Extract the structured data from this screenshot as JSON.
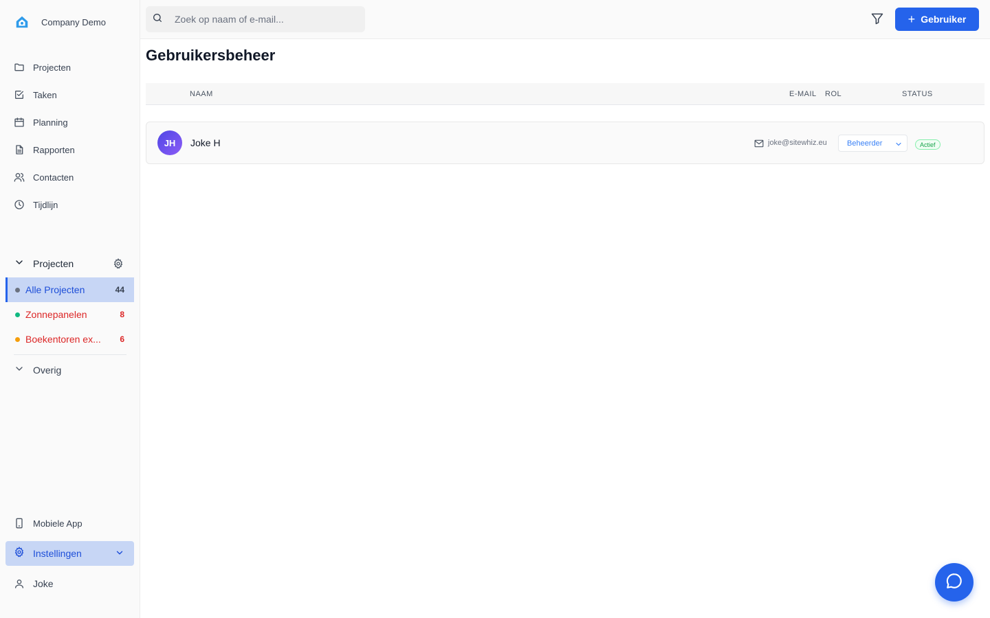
{
  "brand": {
    "name": "Company Demo"
  },
  "nav": [
    {
      "label": "Projecten",
      "icon": "folder-icon"
    },
    {
      "label": "Taken",
      "icon": "checkbox-icon"
    },
    {
      "label": "Planning",
      "icon": "calendar-icon"
    },
    {
      "label": "Rapporten",
      "icon": "document-icon"
    },
    {
      "label": "Contacten",
      "icon": "users-icon"
    },
    {
      "label": "Tijdlijn",
      "icon": "clock-icon"
    }
  ],
  "projects_section": {
    "title": "Projecten",
    "items": [
      {
        "label": "Alle Projecten",
        "count": "44",
        "color": "#6b7280",
        "text_color": "#1d4ed8",
        "count_color": "#374151",
        "active": true
      },
      {
        "label": "Zonnepanelen",
        "count": "8",
        "color": "#10b981",
        "text_color": "#dc2626",
        "count_color": "#dc2626",
        "active": false
      },
      {
        "label": "Boekentoren ex...",
        "count": "6",
        "color": "#f59e0b",
        "text_color": "#dc2626",
        "count_color": "#dc2626",
        "active": false
      }
    ]
  },
  "other_section": {
    "title": "Overig"
  },
  "bottom_nav": {
    "mobile_app": "Mobiele App",
    "settings": "Instellingen",
    "user": "Joke"
  },
  "topbar": {
    "search_placeholder": "Zoek op naam of e-mail...",
    "add_user_label": "Gebruiker"
  },
  "page": {
    "title": "Gebruikersbeheer",
    "columns": {
      "name": "NAAM",
      "email": "E-MAIL",
      "role": "ROL",
      "status": "STATUS"
    },
    "users": [
      {
        "initials": "JH",
        "name": "Joke H",
        "email": "joke@sitewhiz.eu",
        "role": "Beheerder",
        "status": "Actief"
      }
    ]
  },
  "colors": {
    "accent": "#2563eb",
    "active_bg": "#c7d6f5",
    "status_green": "#16a34a"
  }
}
